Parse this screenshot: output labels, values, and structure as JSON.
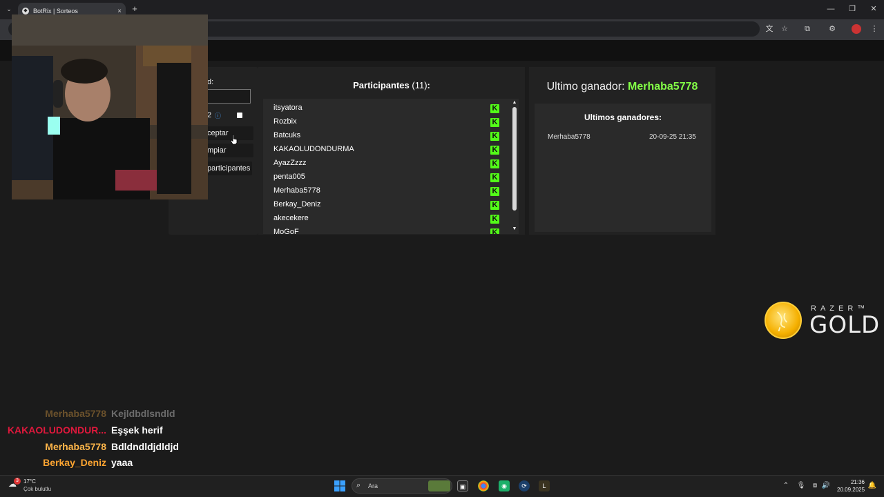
{
  "browser": {
    "tab_title": "BotRix | Sorteos",
    "tab_close": "×",
    "new_tab": "+",
    "tab_list": "⌄",
    "window_controls": [
      "—",
      "❐",
      "✕"
    ]
  },
  "settings": {
    "amount_label": "d:",
    "count_value": "2",
    "info_icon": "ⓘ",
    "accept_label": "ceptar",
    "clear_label": "mpiar",
    "participants_label": "participantes"
  },
  "participants": {
    "title": "Participantes",
    "count": "(11)",
    "colon": ":",
    "items": [
      "itsyatora",
      "Rozbix",
      "Batcuks",
      "KAKAOLUDONDURMA",
      "AyazZzzz",
      "penta005",
      "Merhaba5778",
      "Berkay_Deniz",
      "akecekere",
      "MoGoF"
    ],
    "platform_icon_glyph": "K"
  },
  "winner": {
    "label": "Ultimo ganador:",
    "name": "Merhaba5778",
    "history_title": "Ultimos ganadores:",
    "history": [
      {
        "name": "Merhaba5778",
        "date": "20-09-25 21:35"
      }
    ]
  },
  "razer": {
    "brand": "RAZER™",
    "product": "GOLD"
  },
  "chat": [
    {
      "user": "Merhaba5778",
      "message": "Kejldbdlsndld",
      "color": "#ffb64a",
      "faded": true
    },
    {
      "user": "KAKAOLUDONDUR...",
      "message": "Eşşek herif",
      "color": "#e0183c",
      "faded": false
    },
    {
      "user": "Merhaba5778",
      "message": "Bdldndldjdldjd",
      "color": "#ffb64a",
      "faded": false
    },
    {
      "user": "Berkay_Deniz",
      "message": "yaaa",
      "color": "#ffa531",
      "faded": false
    }
  ],
  "taskbar": {
    "weather_badge": "3",
    "temperature": "17°C",
    "weather": "Çok bulutlu",
    "search_placeholder": "Ara",
    "time": "21:36",
    "date": "20.09.2025"
  },
  "colors": {
    "accent_green": "#83ff47",
    "kick_green": "#53fc18"
  }
}
